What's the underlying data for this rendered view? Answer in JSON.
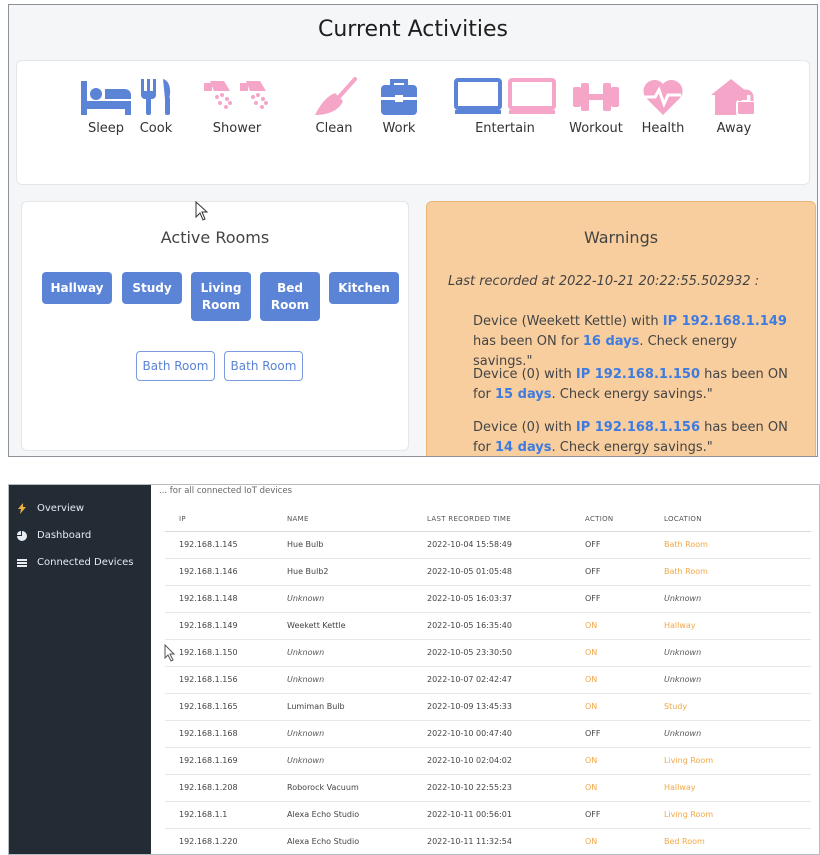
{
  "header": {
    "title": "Current Activities"
  },
  "activities": [
    {
      "label": "Sleep",
      "icon": "bed-icon",
      "color": "#5b84d6"
    },
    {
      "label": "Cook",
      "icon": "fork-knife-icon",
      "color": "#5b84d6"
    },
    {
      "label": "Shower",
      "icon": "shower-icon",
      "color": "#f5a6c8"
    },
    {
      "label": "Clean",
      "icon": "broom-icon",
      "color": "#f5a6c8"
    },
    {
      "label": "Work",
      "icon": "briefcase-icon",
      "color": "#5b84d6"
    },
    {
      "label": "Entertain",
      "icon": "monitor-icon",
      "color": "#5b84d6"
    },
    {
      "label": "Workout",
      "icon": "dumbbell-icon",
      "color": "#f5a6c8"
    },
    {
      "label": "Health",
      "icon": "heart-pulse-icon",
      "color": "#f5a6c8"
    },
    {
      "label": "Away",
      "icon": "home-lock-icon",
      "color": "#f5a6c8"
    }
  ],
  "rooms": {
    "title": "Active Rooms",
    "active": [
      "Hallway",
      "Study",
      "Living Room",
      "Bed Room",
      "Kitchen"
    ],
    "inactive": [
      "Bath Room",
      "Bath Room"
    ]
  },
  "warnings": {
    "title": "Warnings",
    "recorded": "Last recorded at 2022-10-21 20:22:55.502932 :",
    "items": [
      {
        "pre": "Device (Weekett Kettle) with ",
        "ip": "IP 192.168.1.149",
        "mid": " has been ON for ",
        "days": "16 days",
        "post": ". Check energy savings.\""
      },
      {
        "pre": "Device (0) with ",
        "ip": "IP 192.168.1.150",
        "mid": " has been ON for ",
        "days": "15 days",
        "post": ". Check energy savings.\""
      },
      {
        "pre": "Device (0) with ",
        "ip": "IP 192.168.1.156",
        "mid": " has been ON for ",
        "days": "14 days",
        "post": ". Check energy savings.\""
      }
    ]
  },
  "sidebar": {
    "items": [
      {
        "label": "Overview",
        "icon": "lightning-icon"
      },
      {
        "label": "Dashboard",
        "icon": "pie-chart-icon"
      },
      {
        "label": "Connected Devices",
        "icon": "devices-icon"
      }
    ]
  },
  "devices": {
    "caption": "... for all connected IoT devices",
    "columns": [
      "IP",
      "NAME",
      "LAST RECORDED TIME",
      "ACTION",
      "LOCATION"
    ],
    "rows": [
      [
        "192.168.1.145",
        "Hue Bulb",
        "2022-10-04 15:58:49",
        "OFF",
        "Bath Room"
      ],
      [
        "192.168.1.146",
        "Hue Bulb2",
        "2022-10-05 01:05:48",
        "OFF",
        "Bath Room"
      ],
      [
        "192.168.1.148",
        "Unknown",
        "2022-10-05 16:03:37",
        "OFF",
        "Unknown"
      ],
      [
        "192.168.1.149",
        "Weekett Kettle",
        "2022-10-05 16:35:40",
        "ON",
        "Hallway"
      ],
      [
        "192.168.1.150",
        "Unknown",
        "2022-10-05 23:30:50",
        "ON",
        "Unknown"
      ],
      [
        "192.168.1.156",
        "Unknown",
        "2022-10-07 02:42:47",
        "ON",
        "Unknown"
      ],
      [
        "192.168.1.165",
        "Lumiman Bulb",
        "2022-10-09 13:45:33",
        "ON",
        "Study"
      ],
      [
        "192.168.1.168",
        "Unknown",
        "2022-10-10 00:47:40",
        "OFF",
        "Unknown"
      ],
      [
        "192.168.1.169",
        "Unknown",
        "2022-10-10 02:04:02",
        "ON",
        "Living Room"
      ],
      [
        "192.168.1.208",
        "Roborock Vacuum",
        "2022-10-10 22:55:23",
        "ON",
        "Hallway"
      ],
      [
        "192.168.1.1",
        "Alexa Echo Studio",
        "2022-10-11 00:56:01",
        "OFF",
        "Living Room"
      ],
      [
        "192.168.1.220",
        "Alexa Echo Studio",
        "2022-10-11 11:32:54",
        "ON",
        "Bed Room"
      ]
    ]
  }
}
